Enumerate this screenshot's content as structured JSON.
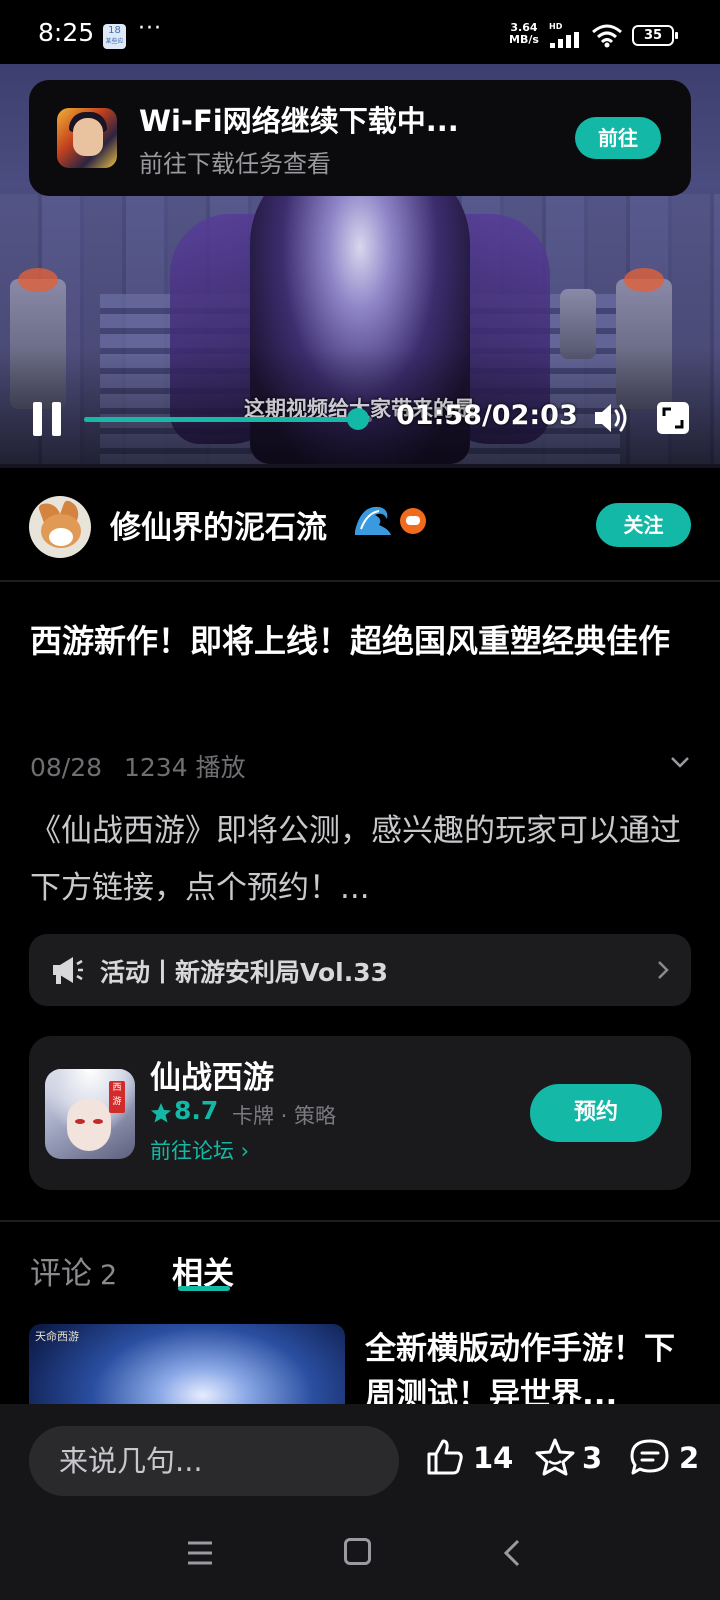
{
  "status_bar": {
    "time": "8:25",
    "badge_top": "18",
    "badge_bottom": "某些应",
    "dots": "···",
    "net_speed_value": "3.64",
    "net_speed_unit": "MB/s",
    "hd": "HD",
    "battery": "35"
  },
  "toast": {
    "title": "Wi-Fi网络继续下载中...",
    "subtitle": "前往下载任务查看",
    "button": "前往"
  },
  "video": {
    "subtitle_text": "这期视频给大家带来的是",
    "time": "01:58/02:03",
    "progress": 0.95,
    "accent": "#14b8a6"
  },
  "author": {
    "name": "修仙界的泥石流",
    "follow": "关注"
  },
  "post": {
    "title": "西游新作！即将上线！超绝国风重塑经典佳作",
    "date": "08/28",
    "plays": "1234 播放",
    "description": "《仙战西游》即将公测，感兴趣的玩家可以通过下方链接，点个预约！..."
  },
  "activity": {
    "label": "活动丨新游安利局Vol.33"
  },
  "game": {
    "name": "仙战西游",
    "rating": "8.7",
    "genre": "卡牌 · 策略",
    "forum_link": "前往论坛 ›",
    "tag": "西游",
    "reserve": "预约"
  },
  "tabs": {
    "comments_label": "评论",
    "comments_count": "2",
    "related_label": "相关"
  },
  "related": {
    "thumb_logo": "天命西游",
    "title": "全新横版动作手游！下周测试！异世界..."
  },
  "bottom_bar": {
    "placeholder": "来说几句...",
    "likes": "14",
    "favorites": "3",
    "comments": "2"
  },
  "icons": {
    "pause": "pause-icon",
    "volume": "volume-icon",
    "fullscreen": "fullscreen-icon",
    "like": "thumbs-up-icon",
    "favorite": "star-icon",
    "comment": "comment-bubble-icon"
  }
}
